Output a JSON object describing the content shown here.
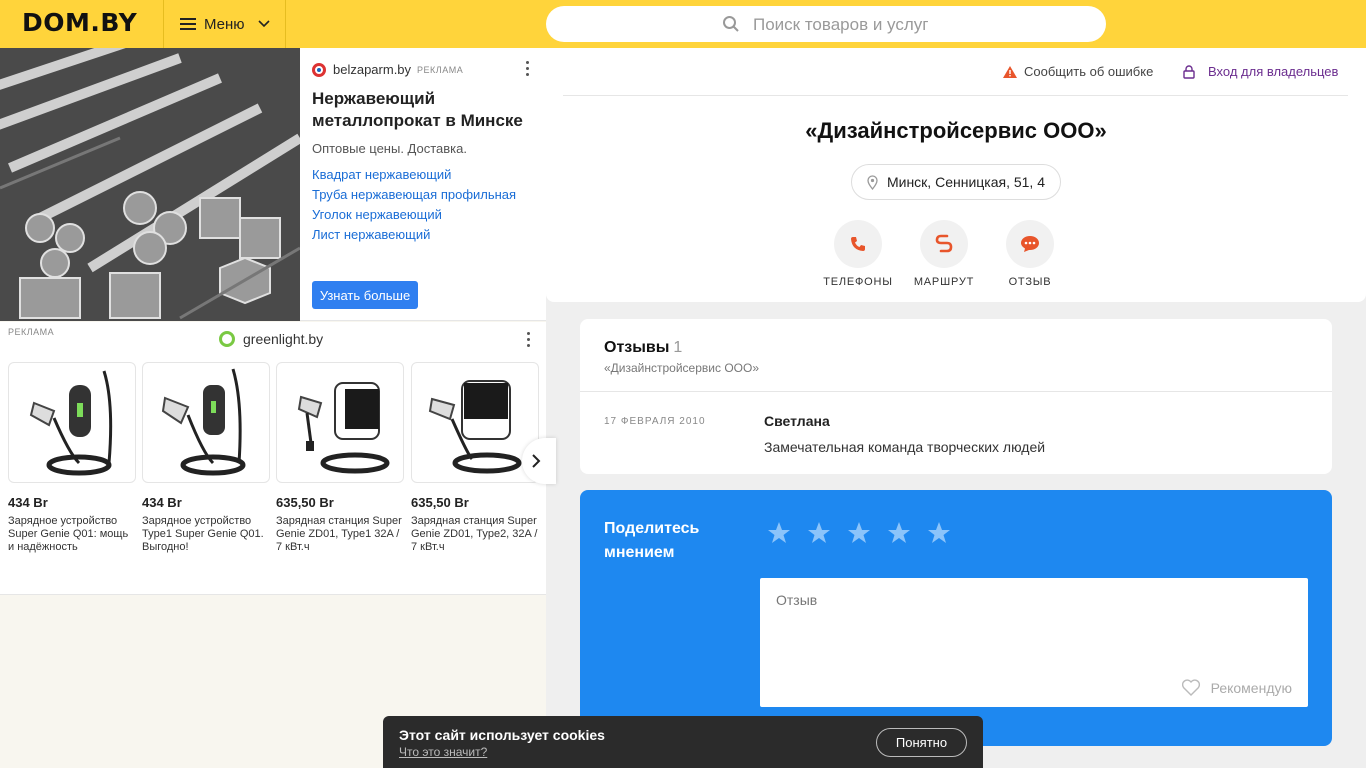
{
  "header": {
    "logo": "DOM.BY",
    "menu_label": "Меню",
    "search_placeholder": "Поиск товаров и услуг"
  },
  "ad1": {
    "source": "belzaparm.by",
    "tag": "РЕКЛАМА",
    "title": "Нержавеющий металлопрокат в Минске",
    "desc": "Оптовые цены. Доставка.",
    "links": [
      "Квадрат нержавеющий",
      "Труба нержавеющая профильная",
      "Уголок нержавеющий",
      "Лист нержавеющий"
    ],
    "cta": "Узнать больше"
  },
  "ad2": {
    "tag": "РЕКЛАМА",
    "brand": "greenlight.by",
    "products": [
      {
        "price": "434 Br",
        "name": "Зарядное устройство Super Genie Q01: мощь и надёжность"
      },
      {
        "price": "434 Br",
        "name": "Зарядное устройство Type1 Super Genie Q01. Выгодно!"
      },
      {
        "price": "635,50 Br",
        "name": "Зарядная станция Super Genie ZD01, Type1 32A / 7 кВт.ч"
      },
      {
        "price": "635,50 Br",
        "name": "Зарядная станция Super Genie ZD01, Type2, 32A / 7 кВт.ч"
      }
    ]
  },
  "card": {
    "report": "Сообщить об ошибке",
    "owners": "Вход для владельцев",
    "company": "«Дизайнстройсервис ООО»",
    "address": "Минск, Сенницкая, 51, 4",
    "actions": {
      "phones": "ТЕЛЕФОНЫ",
      "route": "МАРШРУТ",
      "review": "ОТЗЫВ"
    }
  },
  "reviews": {
    "heading": "Отзывы",
    "count": "1",
    "subtitle": "«Дизайнстройсервис ООО»",
    "items": [
      {
        "date": "17 ФЕВРАЛЯ 2010",
        "author": "Светлана",
        "text": "Замечательная команда творческих людей"
      }
    ]
  },
  "share": {
    "heading": "Поделитесь мнением",
    "placeholder": "Отзыв",
    "recommend": "Рекомендую"
  },
  "cookie": {
    "title": "Этот сайт использует cookies",
    "link": "Что это значит?",
    "button": "Понятно"
  },
  "colors": {
    "header": "#ffd43b",
    "share_bg": "#1e88f0",
    "link": "#1a6dd6",
    "accent_orange": "#e8552b"
  }
}
